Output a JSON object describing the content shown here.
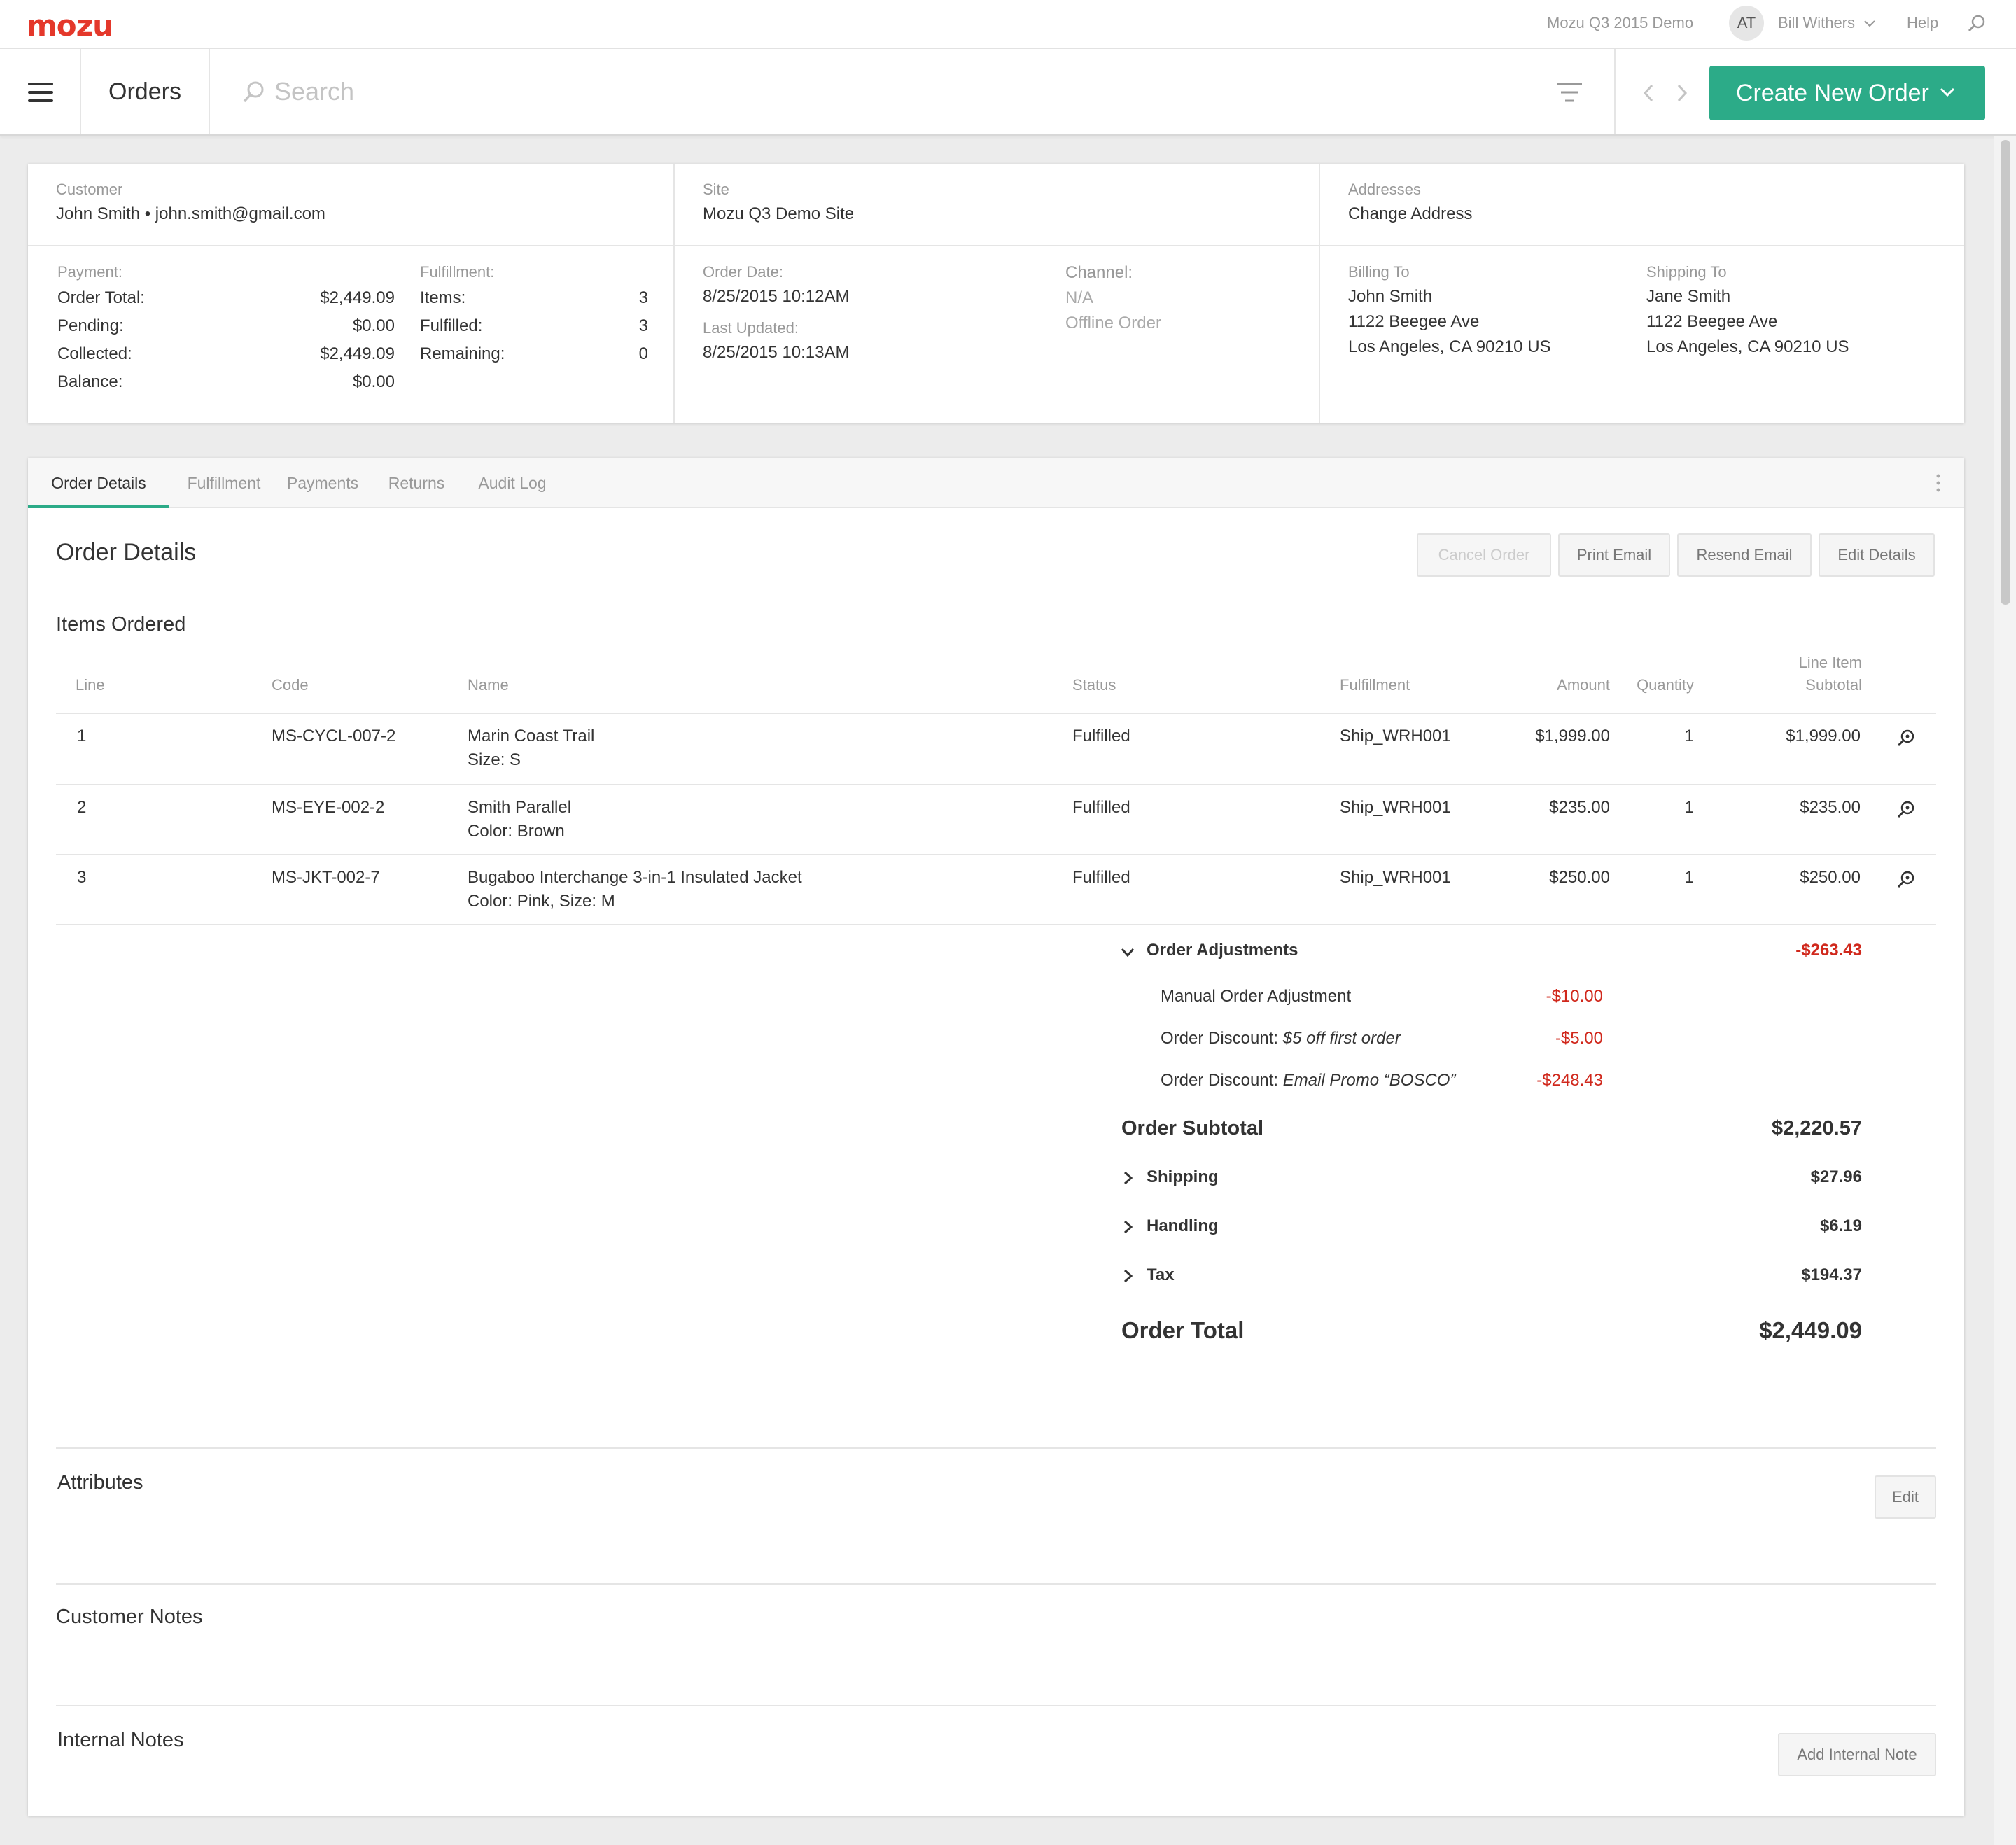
{
  "topbar": {
    "logo": "mozu",
    "tenant": "Mozu Q3 2015 Demo",
    "avatar_initials": "AT",
    "user_name": "Bill Withers",
    "help": "Help"
  },
  "subbar": {
    "title": "Orders",
    "search_placeholder": "Search",
    "create_button": "Create New Order"
  },
  "summary": {
    "customer_label": "Customer",
    "customer_value": "John Smith • john.smith@gmail.com",
    "site_label": "Site",
    "site_value": "Mozu Q3 Demo Site",
    "addresses_label": "Addresses",
    "addresses_value": "Change Address",
    "payment": {
      "label": "Payment:",
      "rows": [
        {
          "label": "Order Total:",
          "value": "$2,449.09"
        },
        {
          "label": "Pending:",
          "value": "$0.00"
        },
        {
          "label": "Collected:",
          "value": "$2,449.09"
        },
        {
          "label": "Balance:",
          "value": "$0.00"
        }
      ]
    },
    "fulfillment": {
      "label": "Fulfillment:",
      "rows": [
        {
          "label": "Items:",
          "value": "3"
        },
        {
          "label": "Fulfilled:",
          "value": "3"
        },
        {
          "label": "Remaining:",
          "value": "0"
        }
      ]
    },
    "order_date_label": "Order Date:",
    "order_date_value": "8/25/2015 10:12AM",
    "last_updated_label": "Last Updated:",
    "last_updated_value": "8/25/2015 10:13AM",
    "channel_label": "Channel:",
    "channel_value": "N/A",
    "channel_type": "Offline Order",
    "billing": {
      "label": "Billing To",
      "name": "John Smith",
      "street": "1122 Beegee Ave",
      "city": "Los Angeles, CA 90210 US"
    },
    "shipping": {
      "label": "Shipping To",
      "name": "Jane Smith",
      "street": "1122 Beegee Ave",
      "city": "Los Angeles, CA 90210 US"
    }
  },
  "tabs": [
    "Order Details",
    "Fulfillment",
    "Payments",
    "Returns",
    "Audit Log"
  ],
  "details": {
    "title": "Order Details",
    "buttons": {
      "cancel": "Cancel Order",
      "print": "Print Email",
      "resend": "Resend Email",
      "edit": "Edit Details"
    },
    "items_title": "Items Ordered",
    "columns": {
      "line": "Line",
      "code": "Code",
      "name": "Name",
      "status": "Status",
      "fulfillment": "Fulfillment",
      "amount": "Amount",
      "quantity": "Quantity",
      "subtotal_1": "Line Item",
      "subtotal_2": "Subtotal"
    },
    "items": [
      {
        "line": "1",
        "code": "MS-CYCL-007-2",
        "name": "Marin Coast Trail",
        "option": "Size: S",
        "status": "Fulfilled",
        "fulfillment": "Ship_WRH001",
        "amount": "$1,999.00",
        "quantity": "1",
        "subtotal": "$1,999.00"
      },
      {
        "line": "2",
        "code": "MS-EYE-002-2",
        "name": "Smith Parallel",
        "option": "Color: Brown",
        "status": "Fulfilled",
        "fulfillment": "Ship_WRH001",
        "amount": "$235.00",
        "quantity": "1",
        "subtotal": "$235.00"
      },
      {
        "line": "3",
        "code": "MS-JKT-002-7",
        "name": "Bugaboo Interchange 3-in-1 Insulated Jacket",
        "option": "Color: Pink, Size: M",
        "status": "Fulfilled",
        "fulfillment": "Ship_WRH001",
        "amount": "$250.00",
        "quantity": "1",
        "subtotal": "$250.00"
      }
    ],
    "adjustments": {
      "label": "Order Adjustments",
      "total": "-$263.43",
      "rows": [
        {
          "prefix": "Manual Order Adjustment",
          "detail": "",
          "value": "-$10.00"
        },
        {
          "prefix": "Order Discount: ",
          "detail": "$5 off first order",
          "value": "-$5.00"
        },
        {
          "prefix": "Order Discount: ",
          "detail": "Email Promo “BOSCO”",
          "value": "-$248.43"
        }
      ]
    },
    "subtotal_label": "Order Subtotal",
    "subtotal_value": "$2,220.57",
    "shipping_label": "Shipping",
    "shipping_value": "$27.96",
    "handling_label": "Handling",
    "handling_value": "$6.19",
    "tax_label": "Tax",
    "tax_value": "$194.37",
    "total_label": "Order Total",
    "total_value": "$2,449.09"
  },
  "attributes": {
    "title": "Attributes",
    "edit": "Edit"
  },
  "customer_notes": {
    "title": "Customer Notes"
  },
  "internal_notes": {
    "title": "Internal Notes",
    "add": "Add Internal Note"
  },
  "colors": {
    "accent": "#2cab88",
    "brand": "#e4382b",
    "negative": "#d0281c"
  }
}
